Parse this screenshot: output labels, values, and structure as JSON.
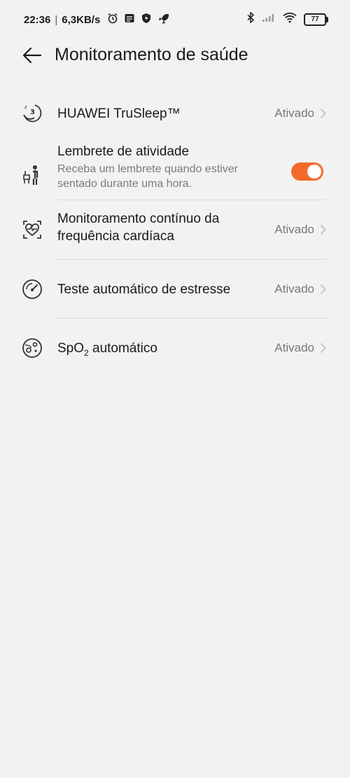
{
  "status_bar": {
    "time": "22:36",
    "speed": "6,3KB/s",
    "battery": "77"
  },
  "header": {
    "title": "Monitoramento de saúde"
  },
  "items": [
    {
      "title": "HUAWEI TruSleep™",
      "value": "Ativado",
      "icon": "sleep-moon-icon"
    },
    {
      "title": "Lembrete de atividade",
      "description_line1": "Receba um lembrete quando estiver",
      "description_line2": "sentado durante uma hora.",
      "toggle_on": true,
      "icon": "person-sitting-icon"
    },
    {
      "title_line1": "Monitoramento contínuo da",
      "title_line2": "frequência cardíaca",
      "value": "Ativado",
      "icon": "heart-rate-icon"
    },
    {
      "title": "Teste automático de estresse",
      "value": "Ativado",
      "icon": "gauge-icon"
    },
    {
      "title_prefix": "SpO",
      "title_sub": "2",
      "title_suffix": " automático",
      "value": "Ativado",
      "icon": "blood-oxygen-icon"
    }
  ],
  "colors": {
    "accent": "#f26b2a",
    "background": "#f2f2f2"
  }
}
